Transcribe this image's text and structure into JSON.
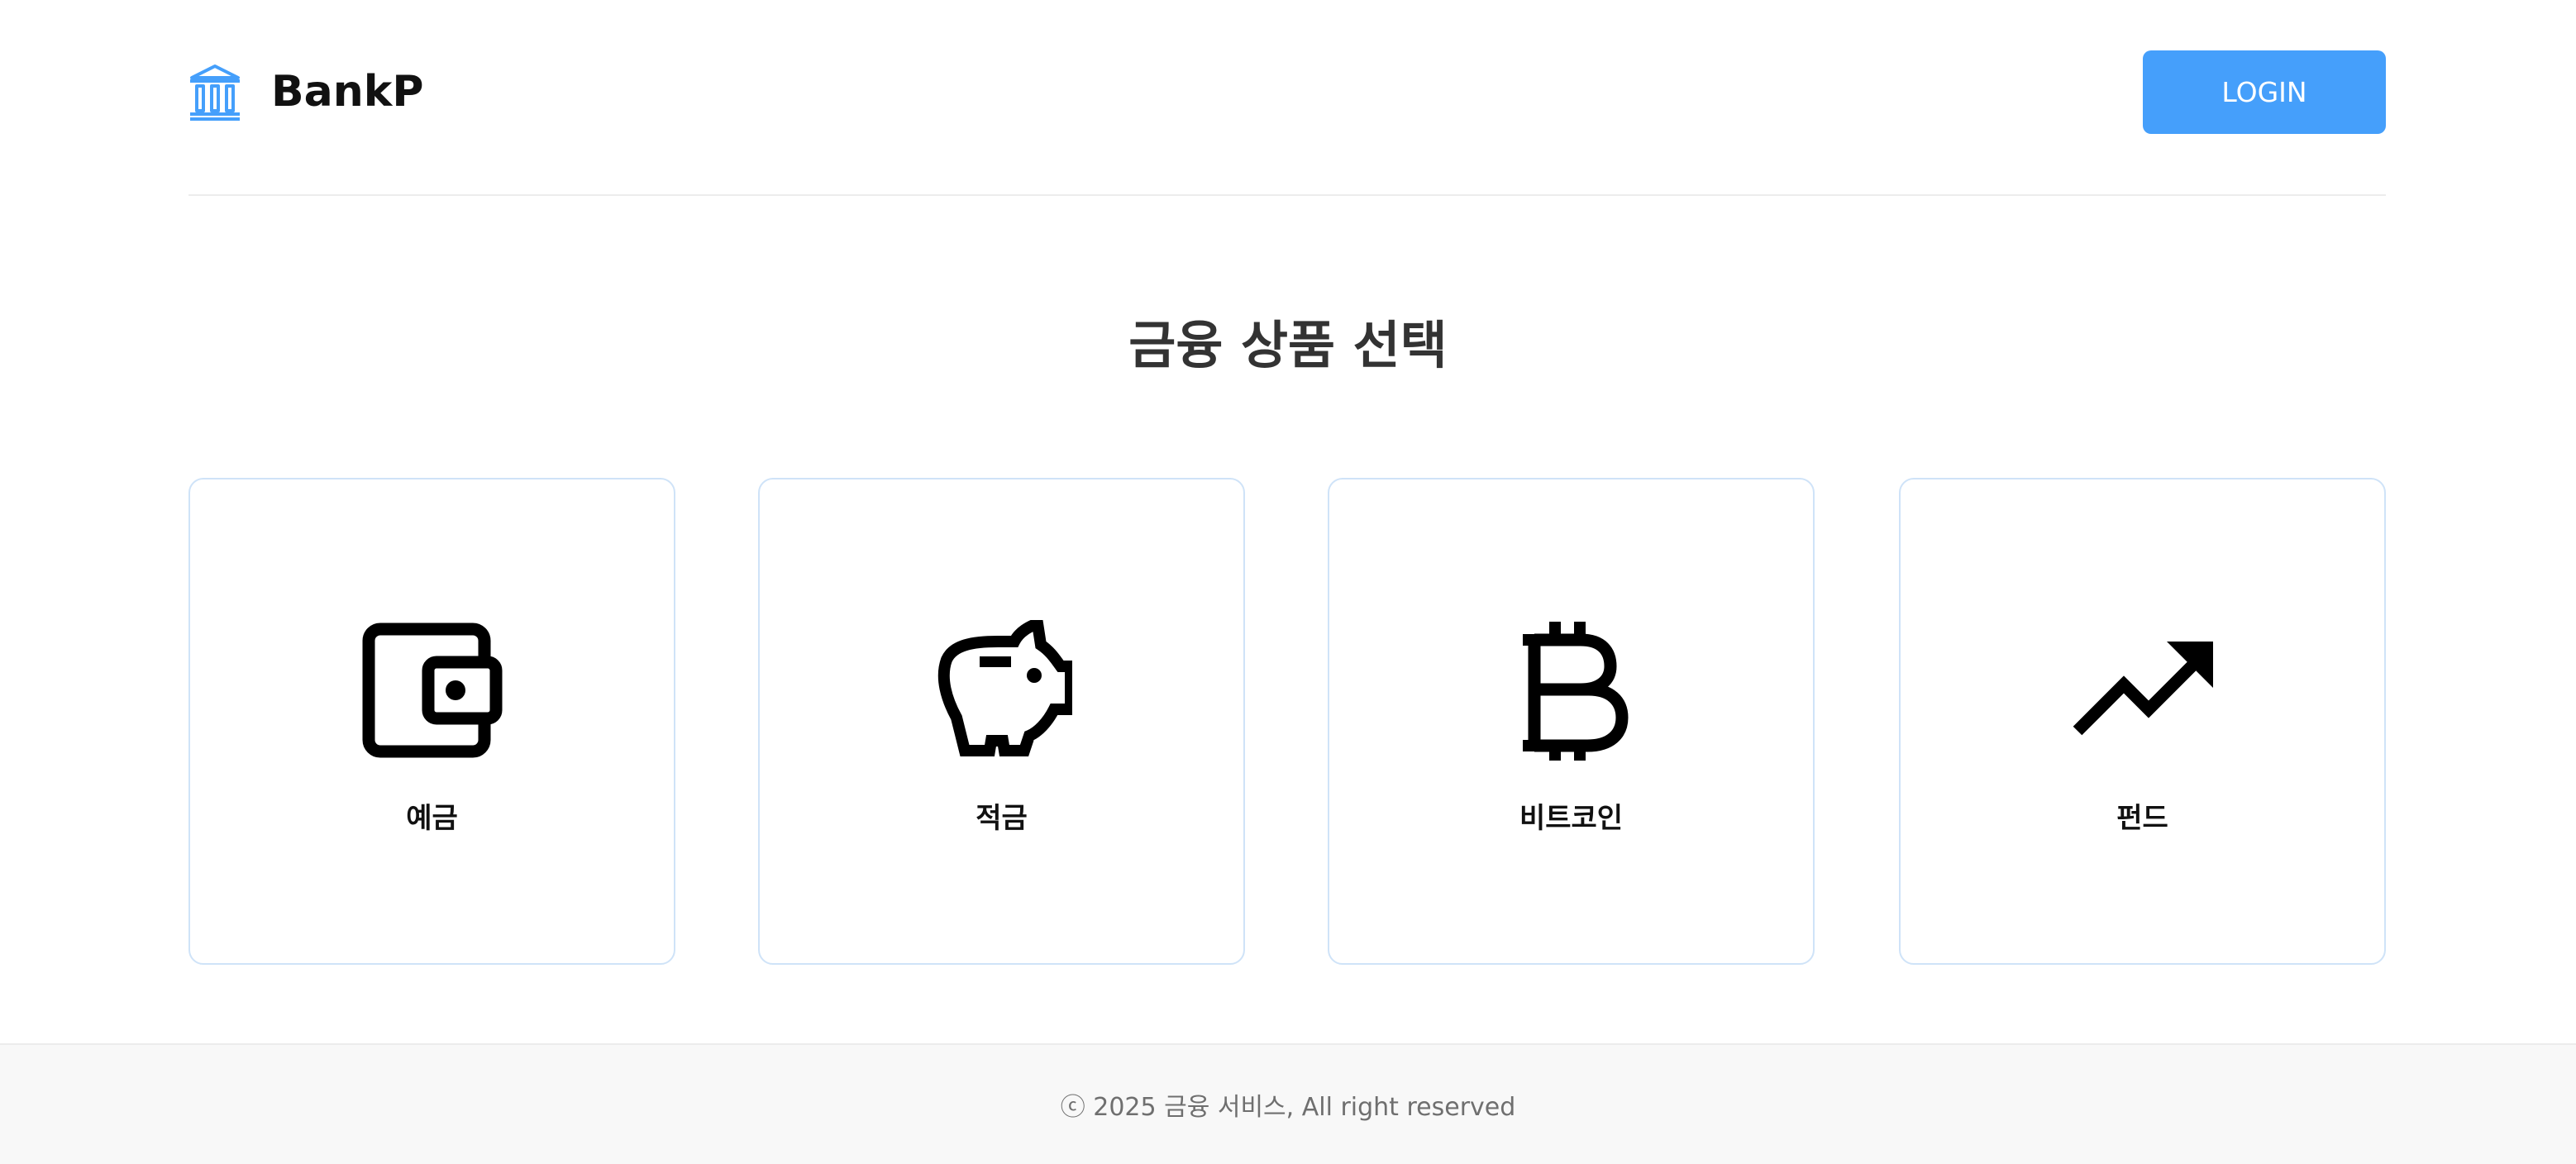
{
  "header": {
    "brand_icon": "bank-icon",
    "brand_name": "BankP",
    "login_label": "LOGIN",
    "accent_color": "#459ffb"
  },
  "main": {
    "title": "금융 상품 선택",
    "products": [
      {
        "label": "예금",
        "icon": "wallet-icon"
      },
      {
        "label": "적금",
        "icon": "piggy-bank-icon"
      },
      {
        "label": "비트코인",
        "icon": "bitcoin-icon"
      },
      {
        "label": "펀드",
        "icon": "trending-up-icon"
      }
    ],
    "card_border_color": "#cfe3f8"
  },
  "footer": {
    "text": "ⓒ 2025 금융 서비스, All right reserved"
  }
}
